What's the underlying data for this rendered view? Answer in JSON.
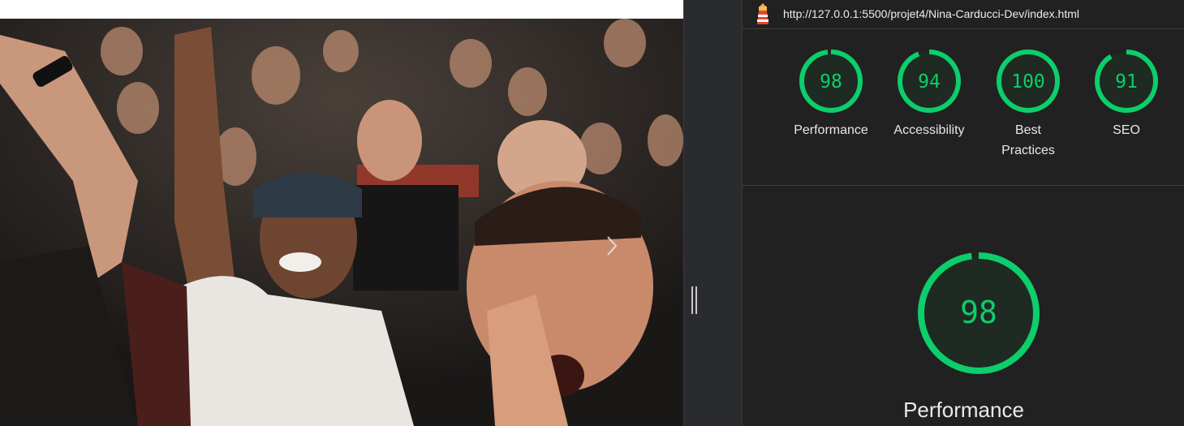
{
  "url": "http://127.0.0.1:5500/projet4/Nina-Carducci-Dev/index.html",
  "accent": "#0cce6b",
  "scores": [
    {
      "label": "Performance",
      "value": 98
    },
    {
      "label": "Accessibility",
      "value": 94
    },
    {
      "label": "Best Practices",
      "value": 100
    },
    {
      "label": "SEO",
      "value": 91
    }
  ],
  "focus": {
    "label": "Performance",
    "value": 98
  },
  "icons": {
    "carousel_next": "chevron-right-icon",
    "logo": "lighthouse-icon",
    "splitter": "grip-vertical-icon"
  }
}
